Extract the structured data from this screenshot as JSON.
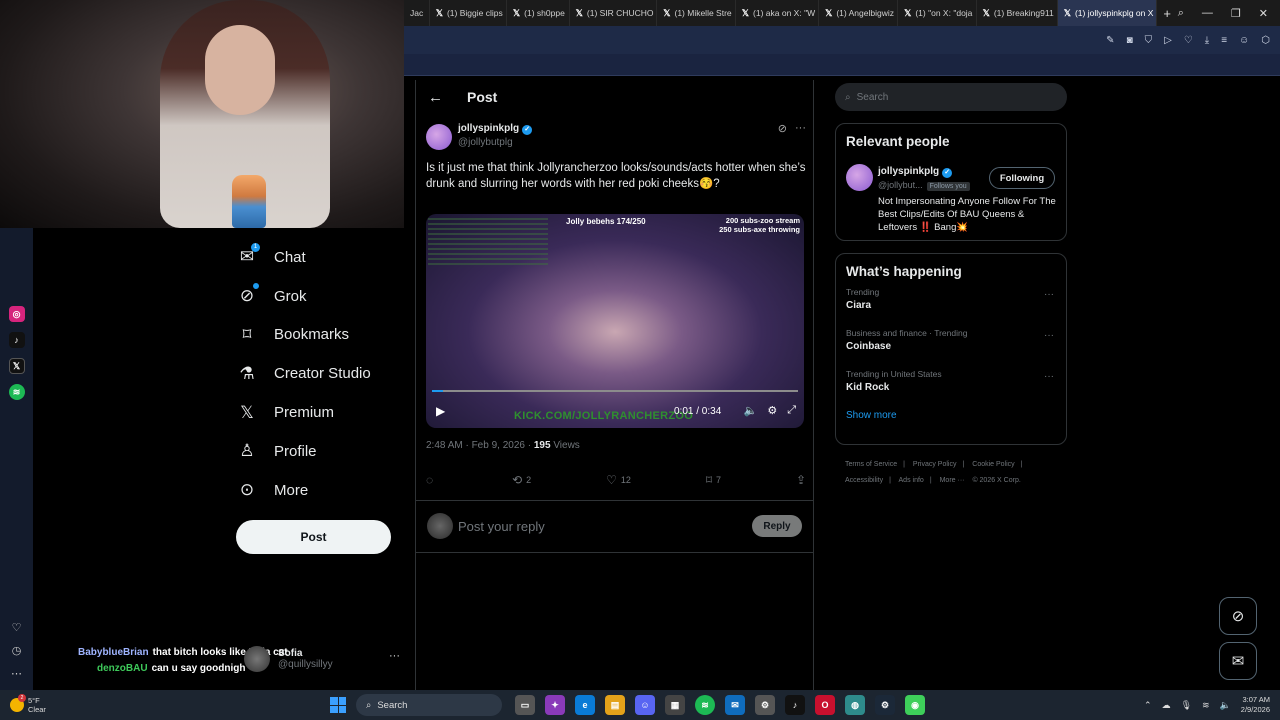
{
  "browser": {
    "tabs": [
      {
        "label": "Jac",
        "x_icon": false
      },
      {
        "label": "(1) Biggie clips",
        "x_icon": true
      },
      {
        "label": "(1) sh0ppe",
        "x_icon": true
      },
      {
        "label": "(1) SIR CHUCHO",
        "x_icon": true
      },
      {
        "label": "(1) Mikelle Stre",
        "x_icon": true
      },
      {
        "label": "(1) aka on X: \"W",
        "x_icon": true
      },
      {
        "label": "(1) Angelbigwiz",
        "x_icon": true
      },
      {
        "label": "(1) \"on X: \"doja",
        "x_icon": true
      },
      {
        "label": "(1) Breaking911",
        "x_icon": true
      },
      {
        "label": "(1) jollyspinkplg on X",
        "x_icon": true,
        "active": true
      }
    ],
    "new_tab": "+",
    "toolbar_icons": [
      "edit-icon",
      "camera-icon",
      "shield-icon",
      "play-icon",
      "heart-icon",
      "download-icon",
      "menu-icon",
      "profile-icon",
      "extension-icon"
    ]
  },
  "nav": {
    "items": [
      {
        "label": "Chat",
        "icon": "mail-icon",
        "badge": "1"
      },
      {
        "label": "Grok",
        "icon": "grok-icon",
        "dot": true
      },
      {
        "label": "Bookmarks",
        "icon": "bookmark-icon"
      },
      {
        "label": "Creator Studio",
        "icon": "flask-icon"
      },
      {
        "label": "Premium",
        "icon": "x-logo-icon"
      },
      {
        "label": "Profile",
        "icon": "person-icon"
      },
      {
        "label": "More",
        "icon": "more-circle-icon"
      }
    ],
    "post_label": "Post"
  },
  "account": {
    "name": "Sofia",
    "handle": "@quillysillyy",
    "more": "···"
  },
  "stream_chat": [
    {
      "user": "BabyblueBrian",
      "message": "that bitch looks like Doja cat"
    },
    {
      "user": "denzoBAU",
      "message": "can u say goodnigh"
    }
  ],
  "post": {
    "header_title": "Post",
    "author_name": "jollyspinkplg",
    "author_handle": "@jollybutplg",
    "text": "Is it just me that think Jollyrancherzoo looks/sounds/acts hotter when she’s drunk and slurring her words with her red poki cheeks😚?",
    "video": {
      "overlay_title": "Jolly bebehs 174/250",
      "overlay_goals": [
        "200 subs-zoo stream",
        "250 subs-axe throwing"
      ],
      "watermark": "KICK.COM/JOLLYRANCHERZOO",
      "time": "0:01 / 0:34",
      "progress": 0.03
    },
    "timestamp": "2:48 AM · Feb 9, 2026 ·",
    "views_count": "195",
    "views_label": "Views",
    "actions": {
      "replies": "",
      "reposts": "2",
      "likes": "12",
      "bookmarks": "7"
    },
    "reply_placeholder": "Post your reply",
    "reply_button": "Reply"
  },
  "sidebar": {
    "search_placeholder": "Search",
    "relevant": {
      "title": "Relevant people",
      "name": "jollyspinkplg",
      "handle": "@jollybut...",
      "follows_you": "Follows you",
      "follow_button": "Following",
      "bio": "Not Impersonating Anyone Follow For The Best Clips/Edits Of BAU Queens & Leftovers ‼️ Bang💥"
    },
    "happening": {
      "title": "What’s happening",
      "trends": [
        {
          "context": "Trending",
          "name": "Ciara"
        },
        {
          "context": "Business and finance · Trending",
          "name": "Coinbase"
        },
        {
          "context": "Trending in United States",
          "name": "Kid Rock"
        }
      ],
      "show_more": "Show more"
    },
    "footer": [
      "Terms of Service",
      "|",
      "Privacy Policy",
      "|",
      "Cookie Policy",
      "|",
      "Accessibility",
      "|",
      "Ads info",
      "|",
      "More ···",
      "© 2026 X Corp."
    ]
  },
  "taskbar": {
    "weather_temp": "5°F",
    "weather_desc": "Clear",
    "weather_badge": "2",
    "search_label": "Search",
    "time": "3:07 AM",
    "date": "2/9/2026"
  }
}
